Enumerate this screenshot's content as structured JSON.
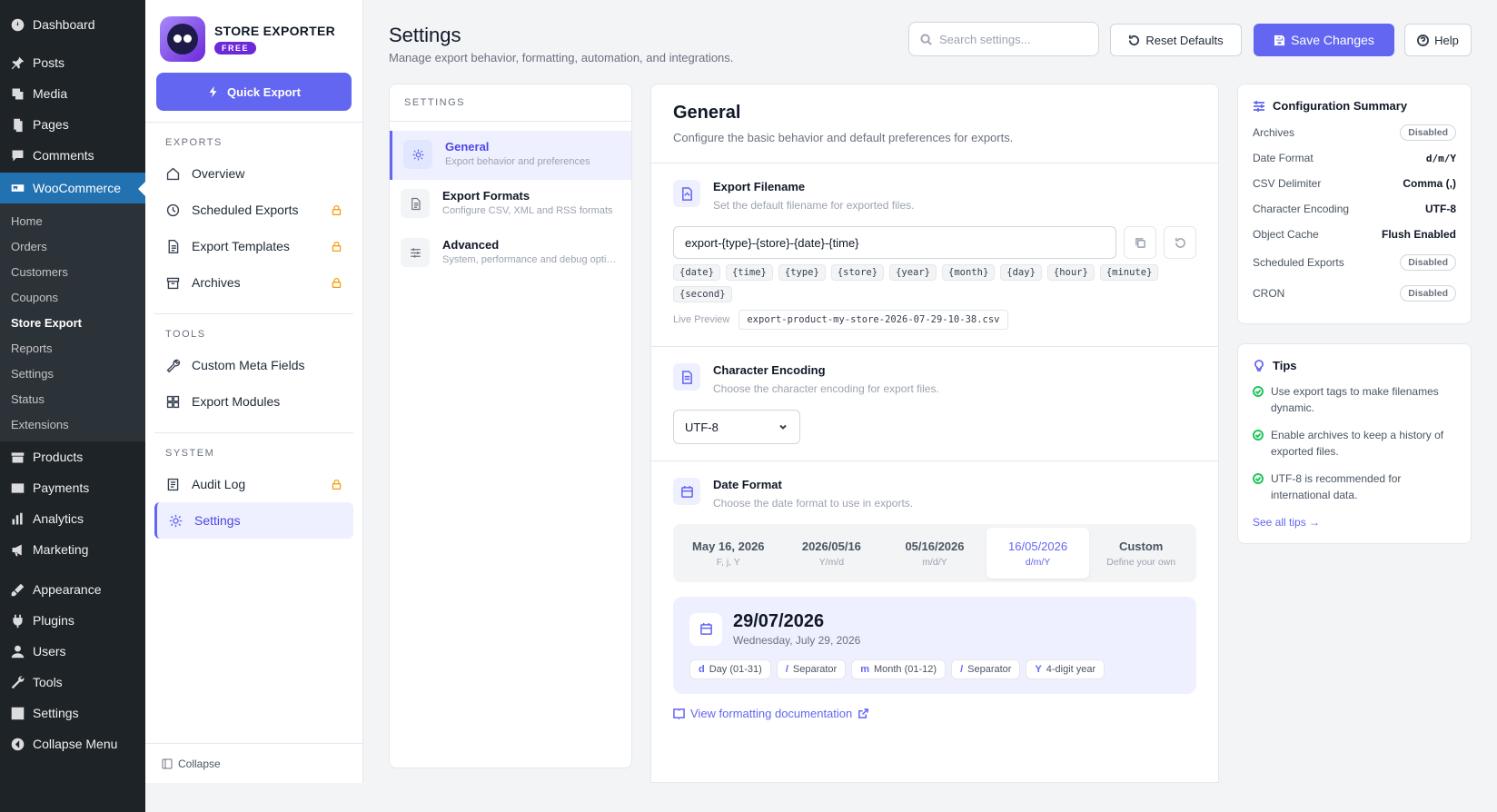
{
  "wp_menu": {
    "top": [
      {
        "label": "Dashboard",
        "icon": "dashboard-icon"
      }
    ],
    "main": [
      {
        "label": "Posts",
        "icon": "pin-icon"
      },
      {
        "label": "Media",
        "icon": "media-icon"
      },
      {
        "label": "Pages",
        "icon": "pages-icon"
      },
      {
        "label": "Comments",
        "icon": "comment-icon"
      }
    ],
    "woocommerce": "WooCommerce",
    "woo_sub": [
      "Home",
      "Orders",
      "Customers",
      "Coupons",
      "Store Export",
      "Reports",
      "Settings",
      "Status",
      "Extensions"
    ],
    "lower": [
      {
        "label": "Products",
        "icon": "products-icon"
      },
      {
        "label": "Payments",
        "icon": "payments-icon"
      },
      {
        "label": "Analytics",
        "icon": "analytics-icon"
      },
      {
        "label": "Marketing",
        "icon": "megaphone-icon"
      }
    ],
    "bottom": [
      {
        "label": "Appearance",
        "icon": "brush-icon"
      },
      {
        "label": "Plugins",
        "icon": "plug-icon"
      },
      {
        "label": "Users",
        "icon": "user-icon"
      },
      {
        "label": "Tools",
        "icon": "wrench-icon"
      },
      {
        "label": "Settings",
        "icon": "settings-icon"
      },
      {
        "label": "Collapse Menu",
        "icon": "collapse-icon"
      }
    ]
  },
  "plugin": {
    "title": "STORE EXPORTER",
    "badge": "FREE",
    "quick_export": "Quick Export",
    "sections": {
      "exports": "EXPORTS",
      "tools": "TOOLS",
      "system": "SYSTEM"
    },
    "exports_items": [
      "Overview",
      "Scheduled Exports",
      "Export Templates",
      "Archives"
    ],
    "tools_items": [
      "Custom Meta Fields",
      "Export Modules"
    ],
    "system_items": [
      "Audit Log",
      "Settings"
    ],
    "collapse": "Collapse"
  },
  "header": {
    "title": "Settings",
    "subtitle": "Manage export behavior, formatting, automation, and integrations.",
    "search_placeholder": "Search settings...",
    "reset": "Reset Defaults",
    "save": "Save Changes",
    "help": "Help"
  },
  "settings_nav": {
    "caption": "SETTINGS",
    "items": [
      {
        "title": "General",
        "desc": "Export behavior and preferences"
      },
      {
        "title": "Export Formats",
        "desc": "Configure CSV, XML and RSS formats"
      },
      {
        "title": "Advanced",
        "desc": "System, performance and debug options"
      }
    ]
  },
  "general": {
    "title": "General",
    "lead": "Configure the basic behavior and default preferences for exports.",
    "filename": {
      "title": "Export Filename",
      "desc": "Set the default filename for exported files.",
      "value": "export-{type}-{store}-{date}-{time}",
      "tags": [
        "{date}",
        "{time}",
        "{type}",
        "{store}",
        "{year}",
        "{month}",
        "{day}",
        "{hour}",
        "{minute}",
        "{second}"
      ],
      "preview_label": "Live Preview",
      "preview_value": "export-product-my-store-2026-07-29-10-38.csv"
    },
    "encoding": {
      "title": "Character Encoding",
      "desc": "Choose the character encoding for export files.",
      "value": "UTF-8"
    },
    "date": {
      "title": "Date Format",
      "desc": "Choose the date format to use in exports.",
      "options": [
        {
          "label": "May 16, 2026",
          "fmt": "F, j, Y"
        },
        {
          "label": "2026/05/16",
          "fmt": "Y/m/d"
        },
        {
          "label": "05/16/2026",
          "fmt": "m/d/Y"
        },
        {
          "label": "16/05/2026",
          "fmt": "d/m/Y"
        },
        {
          "label": "Custom",
          "fmt": "Define your own"
        }
      ],
      "selected_index": 3,
      "preview_big": "29/07/2026",
      "preview_small": "Wednesday, July 29, 2026",
      "chips": [
        {
          "k": "d",
          "v": "Day (01-31)"
        },
        {
          "k": "/",
          "v": "Separator"
        },
        {
          "k": "m",
          "v": "Month (01-12)"
        },
        {
          "k": "/",
          "v": "Separator"
        },
        {
          "k": "Y",
          "v": "4-digit year"
        }
      ],
      "doc_link": "View formatting documentation"
    }
  },
  "summary": {
    "title": "Configuration Summary",
    "rows": [
      {
        "k": "Archives",
        "v": "Disabled",
        "style": "pill"
      },
      {
        "k": "Date Format",
        "v": "d/m/Y",
        "style": "mono"
      },
      {
        "k": "CSV Delimiter",
        "v": "Comma (,)",
        "style": "bold"
      },
      {
        "k": "Character Encoding",
        "v": "UTF-8",
        "style": "bold"
      },
      {
        "k": "Object Cache",
        "v": "Flush Enabled",
        "style": "bold"
      },
      {
        "k": "Scheduled Exports",
        "v": "Disabled",
        "style": "pill"
      },
      {
        "k": "CRON",
        "v": "Disabled",
        "style": "pill"
      }
    ]
  },
  "tips": {
    "title": "Tips",
    "items": [
      "Use export tags to make filenames dynamic.",
      "Enable archives to keep a history of exported files.",
      "UTF-8 is recommended for international data."
    ],
    "see_all": "See all tips →"
  },
  "colors": {
    "accent": "#6366f1",
    "wp_sidebar": "#1d2327",
    "woo_active": "#2271b1"
  }
}
